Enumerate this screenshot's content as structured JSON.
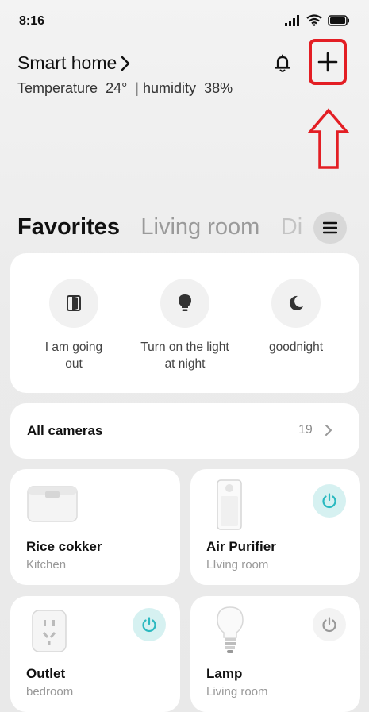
{
  "status_bar": {
    "time": "8:16"
  },
  "header": {
    "title": "Smart home",
    "temperature_label": "Temperature",
    "temperature_value": "24°",
    "separator": "|",
    "humidity_label": "humidity",
    "humidity_value": "38%"
  },
  "tabs": [
    {
      "label": "Favorites",
      "active": true
    },
    {
      "label": "Living room",
      "active": false
    },
    {
      "label": "Di",
      "active": false
    }
  ],
  "scenes": [
    {
      "label": "I am going out",
      "icon": "door-exit-icon"
    },
    {
      "label": "Turn on the light at night",
      "icon": "lightbulb-icon"
    },
    {
      "label": "goodnight",
      "icon": "moon-icon"
    }
  ],
  "cameras": {
    "title": "All cameras",
    "count": "19"
  },
  "devices": [
    {
      "name": "Rice cokker",
      "room": "Kitchen",
      "icon": "rice-cooker-icon",
      "power": null
    },
    {
      "name": "Air Purifier",
      "room": "LIving room",
      "icon": "air-purifier-icon",
      "power": "on"
    },
    {
      "name": "Outlet",
      "room": "bedroom",
      "icon": "outlet-icon",
      "power": "on"
    },
    {
      "name": "Lamp",
      "room": "Living room",
      "icon": "lamp-bulb-icon",
      "power": "off"
    }
  ],
  "colors": {
    "accent_teal": "#2bb9c0",
    "power_on_bg": "#d6f1f1",
    "annotation_red": "#e31e24"
  }
}
